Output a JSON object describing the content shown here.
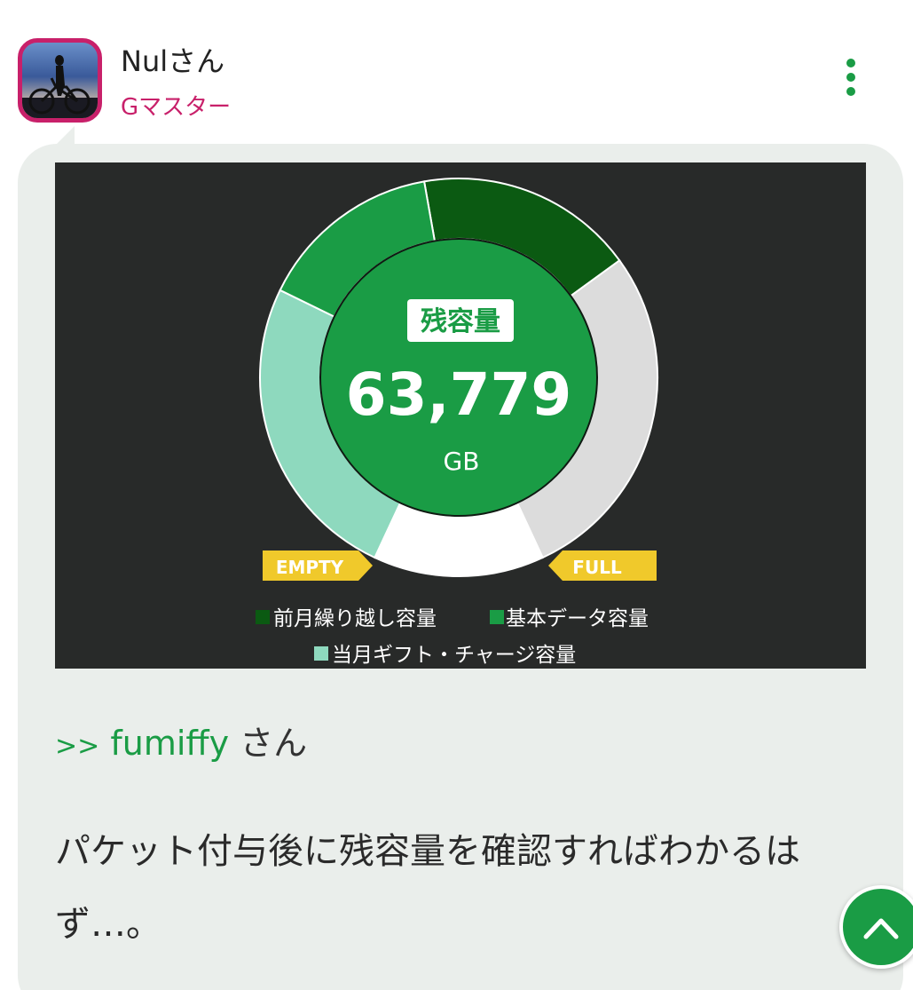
{
  "post": {
    "user_name": "Nulさん",
    "user_rank": "Gマスター",
    "menu_icon": "kebab-icon"
  },
  "figure": {
    "center_label": "残容量",
    "center_value": "63,779",
    "center_unit": "GB",
    "left_tag": "EMPTY",
    "right_tag": "FULL",
    "legend": [
      {
        "label": "前月繰り越し容量",
        "color": "#0b5a12"
      },
      {
        "label": "基本データ容量",
        "color": "#1a9c45"
      },
      {
        "label": "当月ギフト・チャージ容量",
        "color": "#8ed9be"
      }
    ],
    "colors": {
      "background": "#282a29",
      "carryover": "#0b5a12",
      "basic": "#1a9c45",
      "gift": "#8ed9be",
      "empty": "#dcdcdc",
      "tag": "#f0c92b"
    }
  },
  "reply": {
    "arrow": ">>",
    "handle": "fumiffy",
    "suffix": " さん"
  },
  "body": {
    "text": "パケット付与後に残容量を確認すればわかるはず…。"
  },
  "scroll_button": {
    "icon": "chevron-up-icon"
  }
}
